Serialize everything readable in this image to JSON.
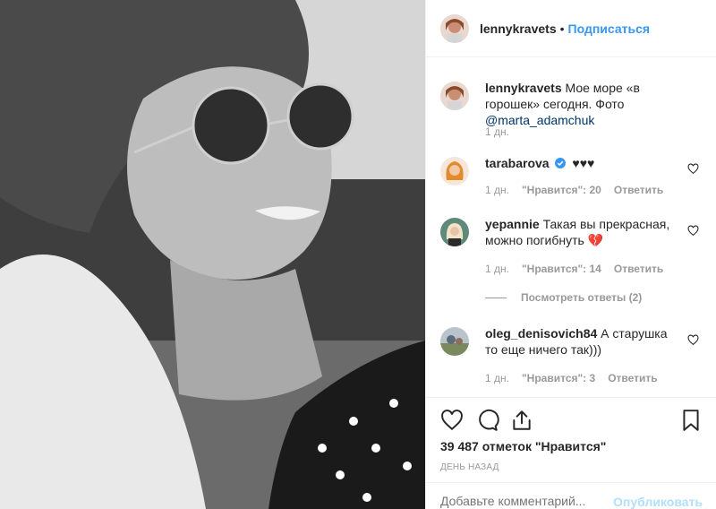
{
  "post": {
    "photo_icon": "portrait-photo"
  },
  "header": {
    "username": "lennykravets",
    "separator": "•",
    "follow_label": "Подписаться"
  },
  "caption": {
    "username": "lennykravets",
    "text": "Мое море «в горошек» сегодня. Фото",
    "mention": "@marta_adamchuk",
    "time": "1 дн."
  },
  "comments": [
    {
      "username": "tarabarova",
      "verified": true,
      "text": "♥♥♥",
      "time": "1 дн.",
      "likes": "\"Нравится\": 20",
      "reply": "Ответить"
    },
    {
      "username": "yepannie",
      "text": "Такая вы прекрасная, можно погибнуть 💔",
      "time": "1 дн.",
      "likes": "\"Нравится\": 14",
      "reply": "Ответить"
    },
    {
      "username": "oleg_denisovich84",
      "text": "А старушка то еще ничего так)))",
      "time": "1 дн.",
      "likes": "\"Нравится\": 3",
      "reply": "Ответить"
    }
  ],
  "view_replies": "Посмотреть ответы (2)",
  "actions": {
    "like_icon": "heart-icon",
    "comment_icon": "comment-icon",
    "share_icon": "share-icon",
    "save_icon": "bookmark-icon",
    "likes_text": "39 487 отметок \"Нравится\"",
    "time_text": "День назад"
  },
  "add_comment": {
    "placeholder": "Добавьте комментарий...",
    "publish_label": "Опубликовать"
  },
  "colors": {
    "accent": "#3897f0",
    "muted": "#999999",
    "verified": "#3897f0"
  }
}
